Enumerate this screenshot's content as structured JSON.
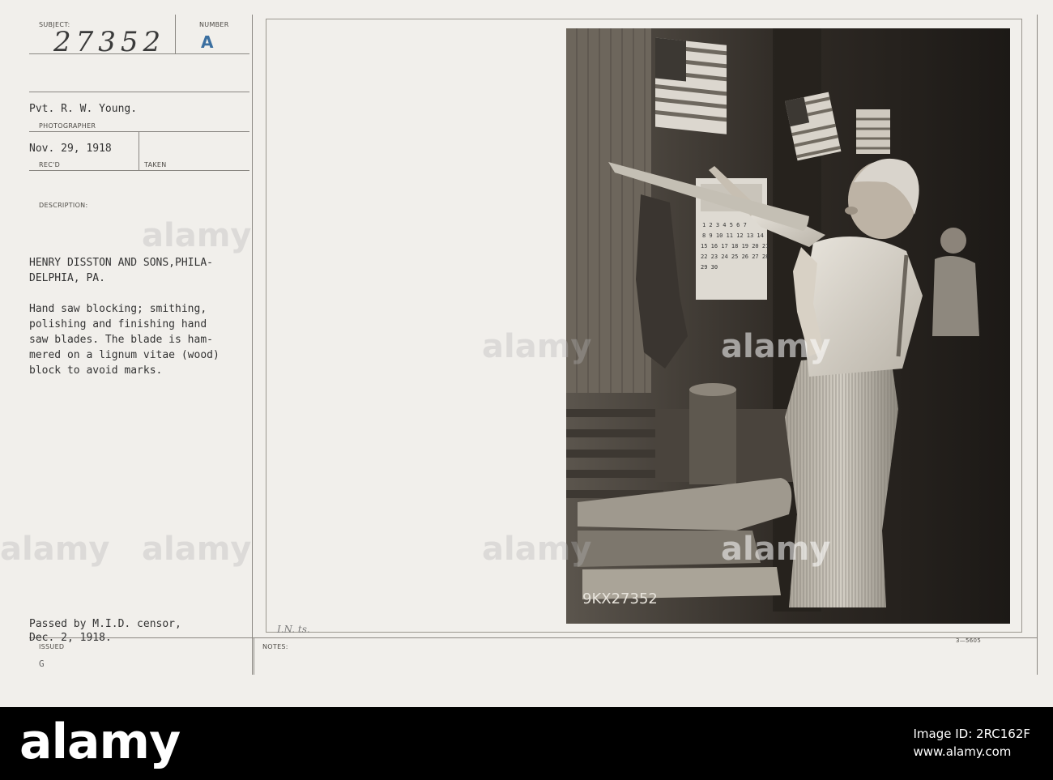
{
  "card": {
    "labels": {
      "subject": "SUBJECT:",
      "number": "NUMBER",
      "photographer": "PHOTOGRAPHER",
      "recd": "REC'D",
      "taken": "TAKEN",
      "description": "DESCRIPTION:",
      "issued": "ISSUED",
      "notes": "NOTES:"
    },
    "subject_number": "27352",
    "number_letter": "A",
    "photographer_name": "Pvt. R. W. Young.",
    "received_date": "Nov. 29, 1918",
    "description_lines": [
      "HENRY DISSTON AND SONS,PHILA-",
      "DELPHIA, PA.",
      "",
      "Hand saw blocking; smithing,",
      "polishing and finishing hand",
      "saw blades. The blade is ham-",
      "mered on a lignum vitae (wood)",
      "block to avoid marks."
    ],
    "censor_lines": [
      "Passed by M.I.D. censor,",
      "Dec. 2, 1918."
    ],
    "issued_mark": "G",
    "notes_initials": "I.N. ts.",
    "form_code": "3—5605",
    "photo_number": "9KX27352",
    "calendar_rows": [
      "1  2  3  4  5  6  7",
      "8  9 10 11 12 13 14",
      "15 16 17 18 19 20 21",
      "22 23 24 25 26 27 28",
      "29 30"
    ]
  },
  "watermark": "alamy",
  "footer": {
    "logo": "alamy",
    "image_id_label": "Image ID: 2RC162F",
    "site": "www.alamy.com"
  },
  "colors": {
    "card_bg": "#f1efeb",
    "rule": "#8a8782",
    "footer_bg": "#000000",
    "stamp_blue": "#3b6fa0"
  }
}
